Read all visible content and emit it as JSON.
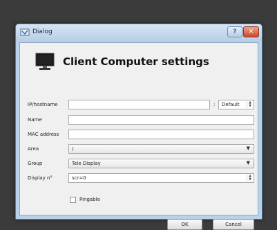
{
  "window": {
    "title": "Dialog"
  },
  "header": {
    "heading": "Client Computer settings"
  },
  "form": {
    "ip_label": "IP/hostname",
    "ip_value": "",
    "port_separator": ":",
    "port_value": "Default",
    "name_label": "Name",
    "name_value": "",
    "mac_label": "MAC address",
    "mac_value": "",
    "area_label": "Area",
    "area_value": "/",
    "group_label": "Group",
    "group_value": "Tele Display",
    "display_label": "Display n°",
    "display_value": "scr=0",
    "pingable_label": "Pingable",
    "pingable_checked": false
  },
  "buttons": {
    "ok": "OK",
    "cancel": "Cancel"
  },
  "icons": {
    "window_icon": "app-icon",
    "monitor": "monitor-icon",
    "help": "help-icon",
    "close": "close-icon"
  },
  "colors": {
    "titlebar": "#c8dcf0",
    "close": "#c94a2a"
  }
}
